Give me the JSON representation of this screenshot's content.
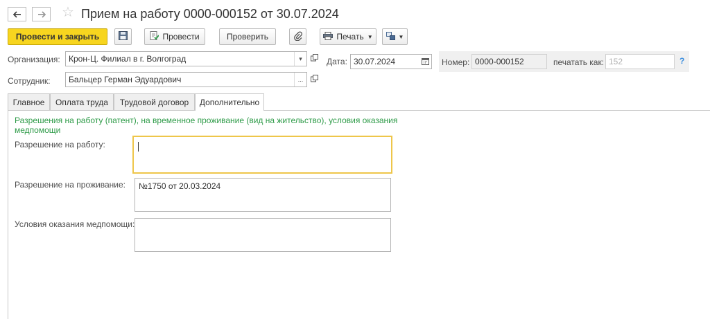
{
  "window": {
    "title": "Прием на работу 0000-000152 от 30.07.2024",
    "back_icon": "arrow-left-icon",
    "forward_icon": "arrow-right-icon",
    "favorite_icon": "star-icon"
  },
  "toolbar": {
    "post_close_label": "Провести и закрыть",
    "post_label": "Провести",
    "check_label": "Проверить",
    "print_label": "Печать",
    "save_icon": "save-icon",
    "attach_icon": "paperclip-icon",
    "more_icon": "structure-icon"
  },
  "header": {
    "org_label": "Организация:",
    "org_value": "Крон-Ц. Филиал в г. Волгоград",
    "date_label": "Дата:",
    "date_value": "30.07.2024",
    "number_label": "Номер:",
    "number_value": "0000-000152",
    "print_as_label": "печатать как:",
    "print_as_value": "152",
    "help_label": "?",
    "employee_label": "Сотрудник:",
    "employee_value": "Бальцер Герман Эдуардович",
    "ellipsis": "...",
    "dropdown_arrow": "▾"
  },
  "tabs": [
    {
      "label": "Главное",
      "active": false
    },
    {
      "label": "Оплата труда",
      "active": false
    },
    {
      "label": "Трудовой договор",
      "active": false
    },
    {
      "label": "Дополнительно",
      "active": true
    }
  ],
  "additional": {
    "section_note": "Разрешения на работу (патент), на временное проживание (вид на жительство), условия оказания медпомощи",
    "work_permit_label": "Разрешение на работу:",
    "work_permit_value": "",
    "residence_permit_label": "Разрешение на проживание:",
    "residence_permit_value": "№1750 от 20.03.2024",
    "medical_label": "Условия оказания медпомощи:",
    "medical_value": ""
  },
  "colors": {
    "primary_button": "#f7d51f",
    "note_text": "#2e9b48",
    "focus_border": "#eec64a",
    "help_link": "#3a8dde"
  }
}
